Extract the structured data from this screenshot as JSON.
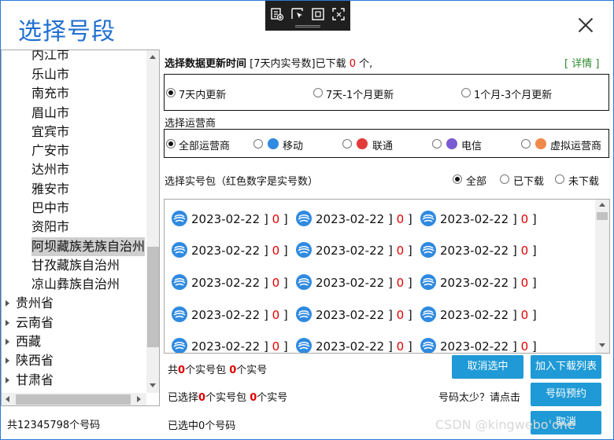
{
  "window": {
    "title": "选择号段"
  },
  "toolbar": {
    "icons": [
      "add-icon",
      "pointer-icon",
      "frame-icon",
      "capture-icon"
    ]
  },
  "tree": {
    "cities": [
      "内江市",
      "乐山市",
      "南充市",
      "眉山市",
      "宜宾市",
      "广安市",
      "达州市",
      "雅安市",
      "巴中市",
      "资阳市",
      "阿坝藏族羌族自治州",
      "甘孜藏族自治州",
      "凉山彝族自治州"
    ],
    "selected_city": "阿坝藏族羌族自治州",
    "provinces": [
      "贵州省",
      "云南省",
      "西藏",
      "陕西省",
      "甘肃省"
    ]
  },
  "left_footer": "共12345798个号码",
  "update": {
    "label": "选择数据更新时间",
    "info_pre": "[7天内实号数]已下载",
    "downloaded": "0",
    "info_post": "个,",
    "detail_open": "[",
    "detail": "详情",
    "detail_close": "]",
    "options": [
      "7天内更新",
      "7天-1个月更新",
      "1个月-3个月更新"
    ],
    "selected": 0
  },
  "operator": {
    "label": "选择运营商",
    "options": [
      "全部运营商",
      "移动",
      "联通",
      "电信",
      "虚拟运营商"
    ],
    "selected": 0,
    "colors": {
      "mobile": "#2f8ae0",
      "unicom": "#e23a3a",
      "telecom": "#7a5bd1",
      "virtual": "#f08a4b"
    }
  },
  "package": {
    "label": "选择实号包（红色数字是实号数）",
    "filters": [
      "全部",
      "已下载",
      "未下载"
    ],
    "selected": 0
  },
  "packages": [
    {
      "date": "2023-02-22",
      "count": "0"
    },
    {
      "date": "2023-02-22",
      "count": "0"
    },
    {
      "date": "2023-02-22",
      "count": "0"
    },
    {
      "date": "2023-02-22",
      "count": "0"
    },
    {
      "date": "2023-02-22",
      "count": "0"
    },
    {
      "date": "2023-02-22",
      "count": "0"
    },
    {
      "date": "2023-02-22",
      "count": "0"
    },
    {
      "date": "2023-02-22",
      "count": "0"
    },
    {
      "date": "2023-02-22",
      "count": "0"
    },
    {
      "date": "2023-02-22",
      "count": "0"
    },
    {
      "date": "2023-02-22",
      "count": "0"
    },
    {
      "date": "2023-02-22",
      "count": "0"
    },
    {
      "date": "2023-02-22",
      "count": "0"
    },
    {
      "date": "2023-02-22",
      "count": "0"
    },
    {
      "date": "2023-02-22",
      "count": "0"
    }
  ],
  "summary": {
    "total_pre": "共",
    "total_pkgs": "0",
    "total_mid": "个实号包",
    "total_nums": "0",
    "total_post": "个实号",
    "sel_pre": "已选择",
    "sel_pkgs": "0",
    "sel_mid": "个实号包",
    "sel_nums": "0",
    "sel_post": "个实号",
    "selected_numbers": "已选中0个号码",
    "too_few": "号码太少？请点击"
  },
  "buttons": {
    "cancel_select": "取消选中",
    "add_download": "加入下载列表",
    "reserve": "号码预约",
    "cancel": "取消"
  },
  "watermark": "CSDN @kingwebo'one"
}
